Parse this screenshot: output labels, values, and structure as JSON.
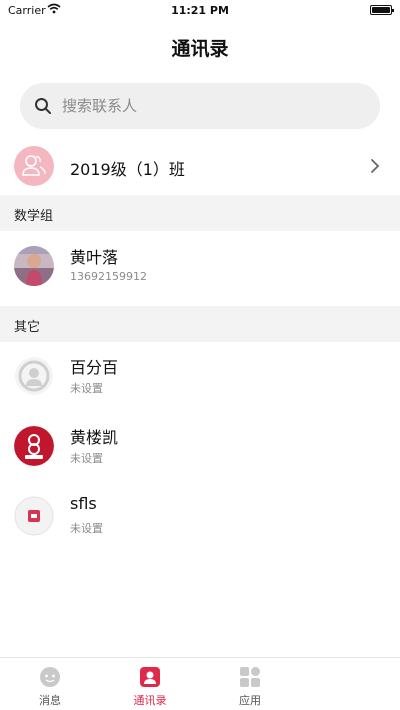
{
  "status_bar": {
    "carrier": "Carrier",
    "time": "11:21 PM"
  },
  "header": {
    "title": "通讯录"
  },
  "search": {
    "placeholder": "搜索联系人"
  },
  "class_group": {
    "label": "2019级（1）班"
  },
  "sections": [
    {
      "title": "数学组",
      "contacts": [
        {
          "name": "黄叶落",
          "subtitle": "13692159912"
        }
      ]
    },
    {
      "title": "其它",
      "contacts": [
        {
          "name": "百分百",
          "subtitle": "未设置"
        },
        {
          "name": "黄楼凯",
          "subtitle": "未设置"
        },
        {
          "name": "sfls",
          "subtitle": "未设置"
        }
      ]
    }
  ],
  "tabs": [
    {
      "label": "消息",
      "icon": "chat-bubble-icon"
    },
    {
      "label": "通讯录",
      "icon": "contacts-icon",
      "active": true
    },
    {
      "label": "应用",
      "icon": "apps-grid-icon"
    }
  ],
  "colors": {
    "accent": "#e0294a",
    "avatar_pink": "#f4b6c0",
    "section_bg": "#f3f3f3"
  }
}
